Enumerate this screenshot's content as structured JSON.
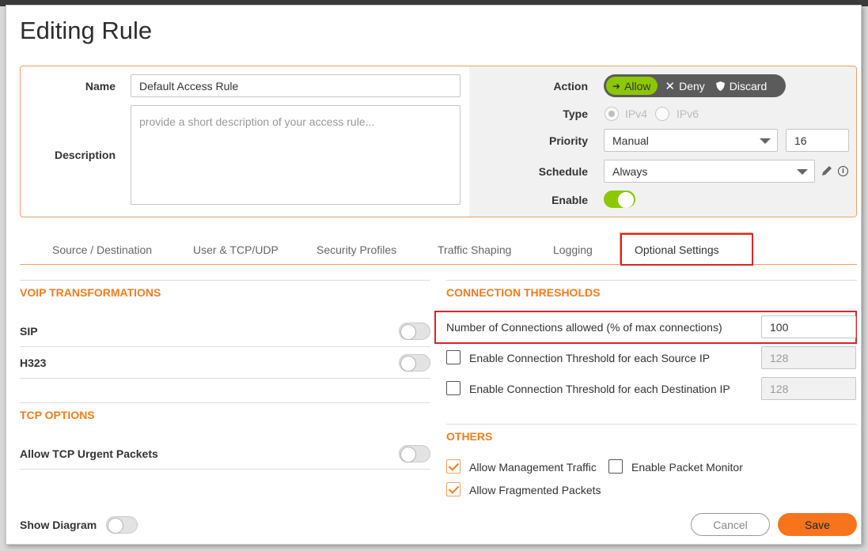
{
  "dialog": {
    "title": "Editing Rule"
  },
  "general": {
    "name_label": "Name",
    "name_value": "Default Access Rule",
    "description_label": "Description",
    "description_placeholder": "provide a short description of your access rule..."
  },
  "settings": {
    "action_label": "Action",
    "actions": [
      {
        "label": "Allow",
        "active": true
      },
      {
        "label": "Deny",
        "active": false
      },
      {
        "label": "Discard",
        "active": false
      }
    ],
    "type_label": "Type",
    "type_options": [
      "IPv4",
      "IPv6"
    ],
    "type_selected": "IPv4",
    "priority_label": "Priority",
    "priority_value": "Manual",
    "priority_number": "16",
    "schedule_label": "Schedule",
    "schedule_value": "Always",
    "enable_label": "Enable",
    "enable_on": true
  },
  "tabs": [
    {
      "label": "Source / Destination"
    },
    {
      "label": "User & TCP/UDP"
    },
    {
      "label": "Security Profiles"
    },
    {
      "label": "Traffic Shaping"
    },
    {
      "label": "Logging"
    },
    {
      "label": "Optional Settings",
      "active": true
    }
  ],
  "voip": {
    "title": "VOIP TRANSFORMATIONS",
    "items": [
      {
        "label": "SIP",
        "on": false
      },
      {
        "label": "H323",
        "on": false
      }
    ]
  },
  "tcp_options": {
    "title": "TCP OPTIONS",
    "items": [
      {
        "label": "Allow TCP Urgent Packets",
        "on": false
      }
    ]
  },
  "connection_thresholds": {
    "title": "CONNECTION THRESHOLDS",
    "max_label": "Number of Connections allowed (% of max connections)",
    "max_value": "100",
    "source_label": "Enable Connection Threshold for each Source IP",
    "source_value": "128",
    "source_checked": false,
    "dest_label": "Enable Connection Threshold for each Destination IP",
    "dest_value": "128",
    "dest_checked": false
  },
  "others": {
    "title": "OTHERS",
    "mgmt_label": "Allow Management Traffic",
    "mgmt_checked": true,
    "monitor_label": "Enable Packet Monitor",
    "monitor_checked": false,
    "frag_label": "Allow Fragmented Packets",
    "frag_checked": true
  },
  "footer": {
    "show_diagram_label": "Show Diagram",
    "cancel_label": "Cancel",
    "save_label": "Save"
  },
  "colors": {
    "accent": "#ee7d1f",
    "toggle_on": "#8cc800",
    "highlight": "#d9242a",
    "save": "#f7741d"
  }
}
